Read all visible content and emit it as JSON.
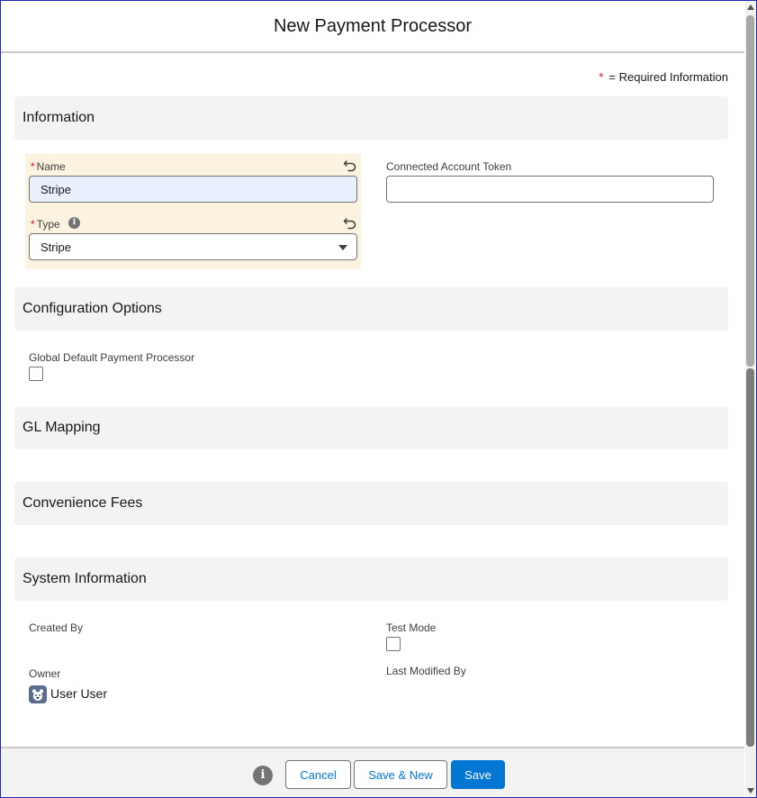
{
  "modal": {
    "title": "New Payment Processor"
  },
  "legend": {
    "star": "*",
    "text": "= Required Information"
  },
  "sections": {
    "information": "Information",
    "configuration": "Configuration Options",
    "gl_mapping": "GL Mapping",
    "convenience_fees": "Convenience Fees",
    "system_information": "System Information"
  },
  "fields": {
    "name": {
      "label": "Name",
      "required_mark": "*",
      "value": "Stripe"
    },
    "type": {
      "label": "Type",
      "required_mark": "*",
      "value": "Stripe",
      "info_glyph": "i"
    },
    "connected_account_token": {
      "label": "Connected Account Token",
      "value": ""
    },
    "global_default": {
      "label": "Global Default Payment Processor",
      "checked": false
    },
    "created_by": {
      "label": "Created By"
    },
    "test_mode": {
      "label": "Test Mode",
      "checked": false
    },
    "owner": {
      "label": "Owner",
      "value": "User User"
    },
    "last_modified_by": {
      "label": "Last Modified By"
    }
  },
  "footer": {
    "info_glyph": "i",
    "cancel_label": "Cancel",
    "save_new_label": "Save & New",
    "save_label": "Save"
  },
  "colors": {
    "brand": "#0176d3",
    "required": "#ea001e",
    "edited_background": "#fbf3e0",
    "section_background": "#f3f3f3"
  },
  "icons": {
    "undo": "undo-icon",
    "info": "info-icon",
    "dropdown": "chevron-down-icon",
    "avatar": "user-avatar-icon"
  }
}
